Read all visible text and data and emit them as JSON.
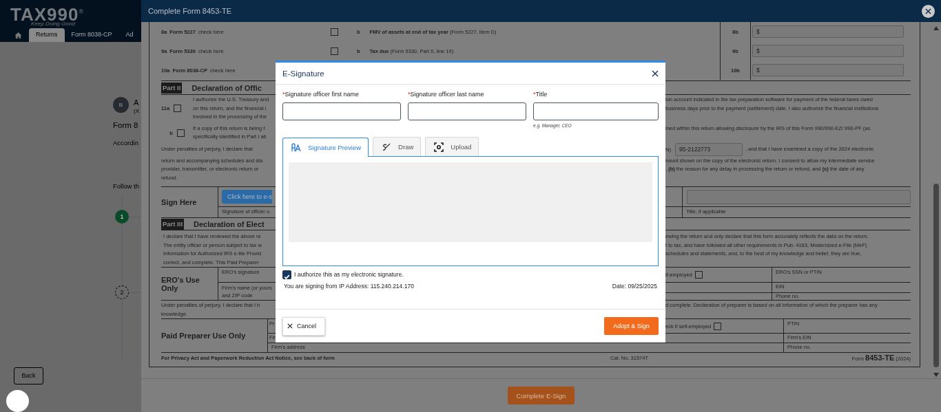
{
  "app": {
    "logo": "TAX990$^{®}$",
    "tagline": "Keep Doing Good",
    "tabs": [
      {
        "label": "Returns",
        "selected": true
      },
      {
        "label": "Form 8038-CP",
        "selected": false
      },
      {
        "label": "Ad",
        "selected": false
      }
    ],
    "org_initial": "B",
    "org_name": "A",
    "org_id": "(X",
    "form_title": "Form 8",
    "intro": "Accordin",
    "steps_intro": "Follow th",
    "steps": [
      {
        "number": "1",
        "done": true
      },
      {
        "number": "2",
        "done": false
      }
    ],
    "back_button": "Back"
  },
  "dialog": {
    "title": "Complete Form 8453-TE",
    "complete_button": "Complete E-Sign"
  },
  "form": {
    "amount_rows": [
      {
        "line": "8a",
        "form": "Form 5227",
        "check_label": "check here",
        "checked": false,
        "sub": "b",
        "desc": "**FMV of assets at end of tax year** (Form 5227, Item D)",
        "line_b": "8b",
        "currency": "$"
      },
      {
        "line": "9a",
        "form": "Form 5330",
        "check_label": "check here",
        "checked": false,
        "sub": "b",
        "desc": "**Tax due** (Form 5330, Part II, line 19)",
        "line_b": "9b",
        "currency": "$"
      },
      {
        "line": "10a",
        "form": "Form 8038-CP",
        "check_label": "check here",
        "line_b": "10b",
        "currency": "$"
      }
    ],
    "part2": {
      "badge": "Part II",
      "title": "Declaration of Offic"
    },
    "auth_11a": {
      "line": "11a",
      "checked": false,
      "left": [
        "I authorize the U.S. Treasury and",
        "on this return, and the financial i",
        "involved in the processing of the"
      ],
      "right": [
        "ion account indicated in the tax preparation software for payment of the federal taxes owed",
        "business days prior to the payment (settlement) date. I also authorize the financial institutions"
      ]
    },
    "auth_b": {
      "line": "b",
      "checked": false,
      "left": [
        "If a copy of this return is being f",
        "specifically identified in Part I ab"
      ],
      "right": [
        "ined within this return allowing disclosure by the IRS of this Form 990/990-EZ/ 990-PF (as"
      ]
    },
    "perjury": {
      "left_first": "Under penalties of perjury, I declare that",
      "left": [
        "return and accompanying schedules and sta",
        "provider, transmitter, or electronic return or",
        "refund."
      ],
      "right_prefix": "N)",
      "ein": "95-2122773",
      "right_first": ", and that I have examined a copy of the 2024 electronic",
      "right": [
        "nount shown on the copy of the electronic return. I consent to allow my intermediate service",
        ", **(b)** the reason for any delay in processing the return or refund, and **(c)** the date of any"
      ]
    },
    "sign": {
      "label": "Sign Here",
      "button": "Click here to e-s",
      "caption": "Signature of officer o",
      "title_caption": "Title, if applicable"
    },
    "part3": {
      "badge": "Part III",
      "title": "Declaration of Elect",
      "left": [
        "I declare that I have reviewed the above re",
        "The entity officer or person subject to tax w",
        "Information for Authorized IRS e-file Provid",
        "correct, and complete. This Paid Preparer"
      ],
      "right": [
        "ewing the return and only declare that this form accurately reflects the data on the return.",
        "t to tax, and have followed all other requirements in Pub. 4163, Modernized e-File (MeF)",
        "schedules and statements, and, to the best of my knowledge and belief, they are true,"
      ]
    },
    "ero": {
      "label": "ERO's Use Only",
      "signature": "ERO's signature",
      "firm": [
        "Firm's name (or yours",
        "and ZIP code"
      ],
      "self_employed": "lf-employed",
      "checked": false,
      "ssn": "ERO's SSN or PTIN",
      "ein": "EIN",
      "phone": "Phone no."
    },
    "perjury2": {
      "left": [
        "Under penalties of perjury, I declare that I h",
        "knowledge."
      ],
      "right": [
        "d complete. Declaration of preparer is based on all information of which the preparer has any"
      ]
    },
    "paid": {
      "label": "Paid Preparer Use Only",
      "name": "Pr",
      "firm": "Fir",
      "address": "Firm's address",
      "self_employed": "eck if self-employed",
      "checked": false,
      "ptin": "PTIN",
      "firm_ein": "Firm's EIN",
      "phone": "Phone no."
    },
    "footer": {
      "notice": "For Privacy Act and Paperwork Reduction Act Notice, see back of form",
      "cat": "Cat. No. 31574T",
      "form_label": "Form **8453-TE** (2024)"
    }
  },
  "modal": {
    "title": "E-Signature",
    "required_mark": "*",
    "fields": [
      {
        "label": "Signature officer first name",
        "required": true
      },
      {
        "label": "Signature officer last name",
        "required": true
      },
      {
        "label": "Title",
        "required": true,
        "hint": "e.g. Manager, CEO"
      }
    ],
    "tabs": [
      {
        "kind": "preview",
        "label": "Signature Preview",
        "selected": true
      },
      {
        "kind": "draw",
        "label": "Draw",
        "selected": false
      },
      {
        "kind": "upload",
        "label": "Upload",
        "selected": false
      }
    ],
    "authorize": {
      "label": "I authorize this as my electronic signature.",
      "checked": true
    },
    "ip": "You are signing from IP Address: 115.240.214.170",
    "date": "Date: 09/25/2025",
    "cancel": "Cancel",
    "adopt": "Adopt & Sign"
  }
}
